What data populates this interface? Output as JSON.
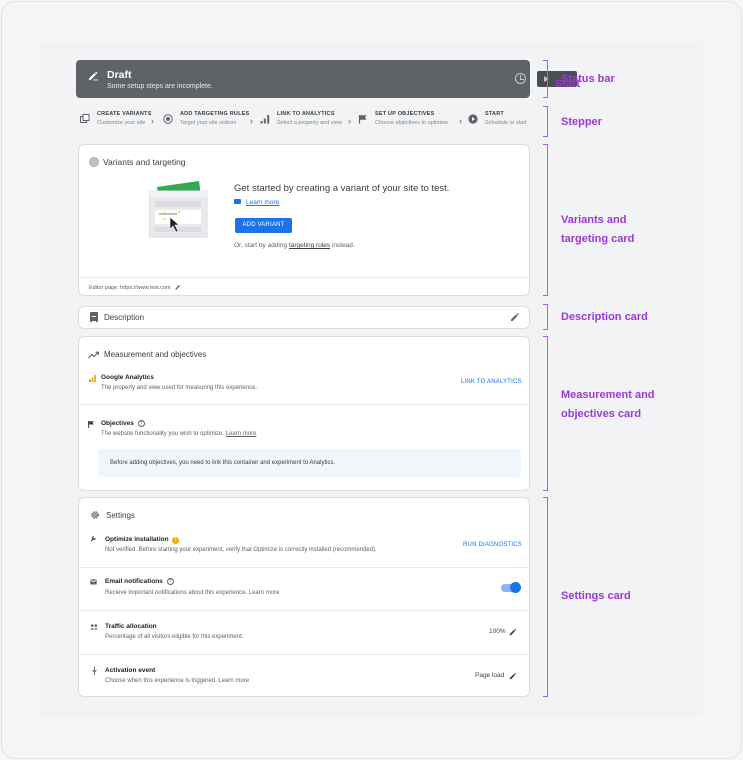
{
  "status_bar": {
    "title": "Draft",
    "subtitle": "Some setup steps are incomplete.",
    "start_label": "Start"
  },
  "stepper": [
    {
      "title": "CREATE VARIANTS",
      "subtitle": "Customize your site"
    },
    {
      "title": "ADD TARGETING RULES",
      "subtitle": "Target your site visitors"
    },
    {
      "title": "LINK TO ANALYTICS",
      "subtitle": "Select a property and view"
    },
    {
      "title": "SET UP OBJECTIVES",
      "subtitle": "Choose objectives to optimize"
    },
    {
      "title": "START",
      "subtitle": "Schedule or start"
    }
  ],
  "variants_card": {
    "heading": "Variants and targeting",
    "get_started": "Get started by creating a variant of your site to test.",
    "learn_more": "Learn more",
    "add_variant": "ADD VARIANT",
    "or_start_prefix": "Or, start by adding",
    "or_start_link": "targeting rules",
    "or_start_suffix": "instead.",
    "editor_page": "Editor page: https://www.test.com"
  },
  "description_card": {
    "heading": "Description"
  },
  "measurement_card": {
    "heading": "Measurement and objectives",
    "ga_title": "Google Analytics",
    "ga_sub": "The property and view used for measuring this experience.",
    "ga_link": "LINK TO ANALYTICS",
    "obj_title": "Objectives",
    "obj_sub": "The website functionality you wish to optimize.",
    "obj_learn": "Learn more",
    "note": "Before adding objectives, you need to link this container and experiment to Analytics."
  },
  "settings_card": {
    "heading": "Settings",
    "rows": [
      {
        "title": "Optimize installation",
        "sub": "Not verified. Before starting your experiment, verify that Optimize is correctly installed (recommended).",
        "action": "RUN DIAGNOSTICS"
      },
      {
        "title": "Email notifications",
        "sub": "Recieve important notifications about this experience. Learn more",
        "toggle_on": true
      },
      {
        "title": "Traffic allocation",
        "sub": "Percentage of all visitors eligible for this experiment.",
        "value": "100%"
      },
      {
        "title": "Activation event",
        "sub": "Choose when this experience is triggered. Learn more",
        "value": "Page load"
      }
    ]
  },
  "annotations": {
    "status_bar": "Status bar",
    "stepper": "Stepper",
    "variants_line1": "Variants and",
    "variants_line2": "targeting card",
    "description": "Description card",
    "measurement_line1": "Measurement and",
    "measurement_line2": "objectives card",
    "settings": "Settings card"
  },
  "colors": {
    "accent": "#1a73e8",
    "annotation": "#9d39d6",
    "status_bar": "#5f6368",
    "warning": "#f9ab00",
    "analytics": "#f9ab00"
  }
}
